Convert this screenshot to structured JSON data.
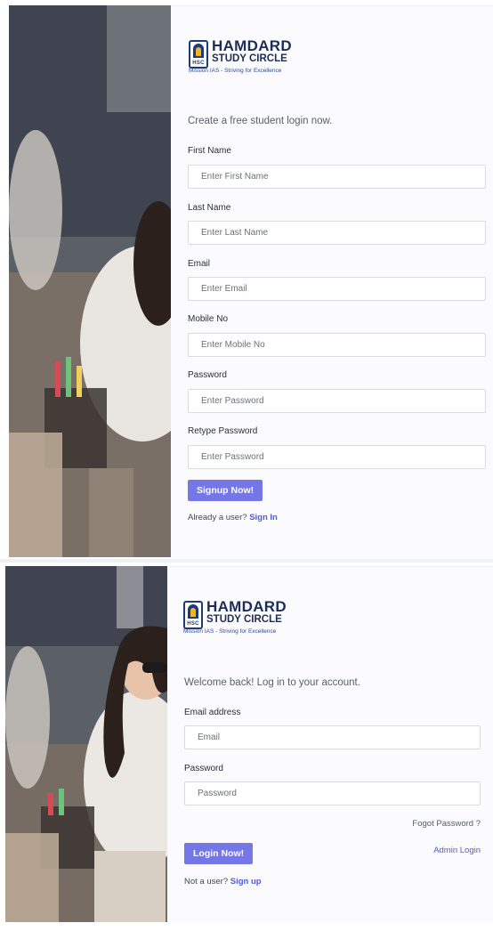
{
  "brand": {
    "title": "HAMDARD",
    "subtitle": "STUDY CIRCLE",
    "tagline": "Mission IAS - Striving for Excellence",
    "mark_text": "HSC",
    "colors": {
      "navy": "#1c2d56",
      "gold": "#f2b423",
      "accent": "#7577e6",
      "link": "#4f5cd6"
    }
  },
  "signup": {
    "intro": "Create a free student login now.",
    "fields": [
      {
        "label": "First Name",
        "placeholder": "Enter First Name",
        "value": ""
      },
      {
        "label": "Last Name",
        "placeholder": "Enter Last Name",
        "value": ""
      },
      {
        "label": "Email",
        "placeholder": "Enter Email",
        "value": ""
      },
      {
        "label": "Mobile No",
        "placeholder": "Enter Mobile No",
        "value": ""
      },
      {
        "label": "Password",
        "placeholder": "Enter Password",
        "value": ""
      },
      {
        "label": "Retype Password",
        "placeholder": "Enter Password",
        "value": ""
      }
    ],
    "submit_label": "Signup Now!",
    "footer_text": "Already a user?",
    "footer_link": "Sign In"
  },
  "login": {
    "intro": "Welcome back! Log in to your account.",
    "fields": [
      {
        "label": "Email address",
        "placeholder": "Email",
        "value": ""
      },
      {
        "label": "Password",
        "placeholder": "Password",
        "value": ""
      }
    ],
    "forgot_label": "Fogot Password ?",
    "admin_label": "Admin Login",
    "submit_label": "Login Now!",
    "footer_text": "Not a user?",
    "footer_link": "Sign up"
  }
}
